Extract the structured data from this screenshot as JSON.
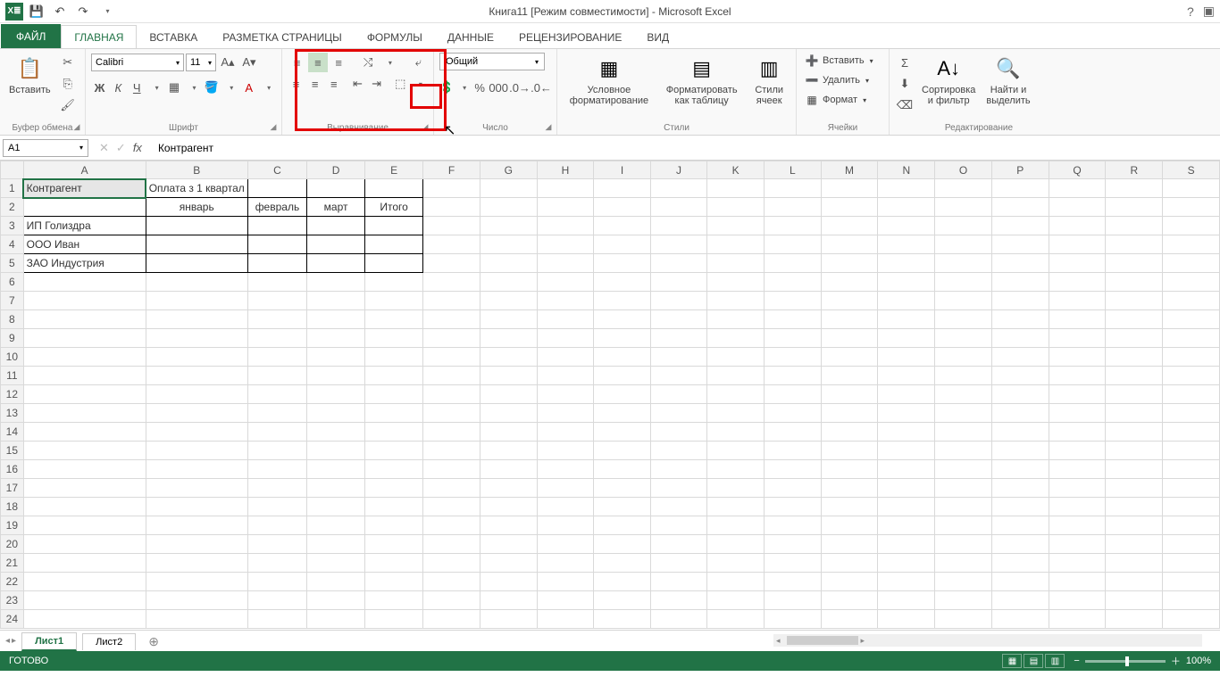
{
  "title": "Книга11 [Режим совместимости] - Microsoft Excel",
  "tabs": {
    "file": "ФАЙЛ",
    "home": "ГЛАВНАЯ",
    "insert": "ВСТАВКА",
    "pagelayout": "РАЗМЕТКА СТРАНИЦЫ",
    "formulas": "ФОРМУЛЫ",
    "data": "ДАННЫЕ",
    "review": "РЕЦЕНЗИРОВАНИЕ",
    "view": "ВИД"
  },
  "ribbon": {
    "clipboard": {
      "paste": "Вставить",
      "label": "Буфер обмена"
    },
    "font": {
      "name": "Calibri",
      "size": "11",
      "label": "Шрифт"
    },
    "alignment": {
      "label": "Выравнивание"
    },
    "number": {
      "format": "Общий",
      "label": "Число"
    },
    "styles": {
      "cond": "Условное\nформатирование",
      "table": "Форматировать\nкак таблицу",
      "cell": "Стили\nячеек",
      "label": "Стили"
    },
    "cells": {
      "insert": "Вставить",
      "delete": "Удалить",
      "format": "Формат",
      "label": "Ячейки"
    },
    "editing": {
      "sort": "Сортировка\nи фильтр",
      "find": "Найти и\nвыделить",
      "label": "Редактирование"
    }
  },
  "namebox": "A1",
  "formula": "Контрагент",
  "columns": [
    "A",
    "B",
    "C",
    "D",
    "E",
    "F",
    "G",
    "H",
    "I",
    "J",
    "K",
    "L",
    "M",
    "N",
    "O",
    "P",
    "Q",
    "R",
    "S"
  ],
  "cells": {
    "A1": "Контрагент",
    "B1": "Оплата з 1 квартал",
    "B2": "январь",
    "C2": "февраль",
    "D2": "март",
    "E2": "Итого",
    "A3": "ИП Голиздра",
    "A4": "ООО Иван",
    "A5": "ЗАО Индустрия"
  },
  "sheets": {
    "s1": "Лист1",
    "s2": "Лист2"
  },
  "status": "ГОТОВО",
  "zoom": "100%"
}
